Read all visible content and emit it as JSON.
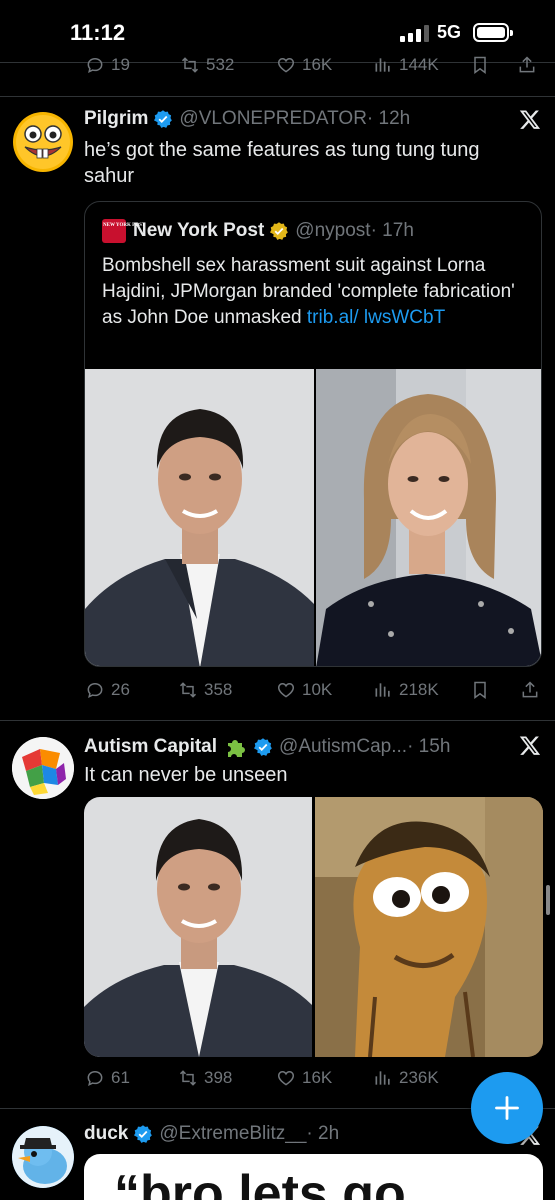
{
  "status": {
    "time": "11:12",
    "network": "5G"
  },
  "prev_actions": {
    "replies": "19",
    "reposts": "532",
    "likes": "16K",
    "views": "144K"
  },
  "tweets": [
    {
      "name": "Pilgrim",
      "handle": "@VLONEPREDATOR",
      "time": "· 12h",
      "text": "he’s got the same features as tung tung tung sahur",
      "quote": {
        "name": "New York Post",
        "handle": "@nypost",
        "time": "· 17h",
        "logo_text": "NEW YORK POST",
        "text": "Bombshell sex harassment suit against Lorna Hajdini, JPMorgan branded 'complete fabrication' as John Doe unmasked ",
        "link": "trib.al/ lwsWCbT"
      },
      "actions": {
        "replies": "26",
        "reposts": "358",
        "likes": "10K",
        "views": "218K"
      }
    },
    {
      "name": "Autism Capital",
      "handle": "@AutismCap...",
      "time": "· 15h",
      "text": "It can never be unseen",
      "actions": {
        "replies": "61",
        "reposts": "398",
        "likes": "16K",
        "views": "236K"
      }
    },
    {
      "name": "duck",
      "handle": "@ExtremeBlitz__",
      "time": "· 2h",
      "image_text": "“bro lets go"
    }
  ],
  "colors": {
    "accent": "#1d9bf0",
    "muted": "#71767b",
    "text": "#e7e9ea",
    "bg": "#000000"
  }
}
